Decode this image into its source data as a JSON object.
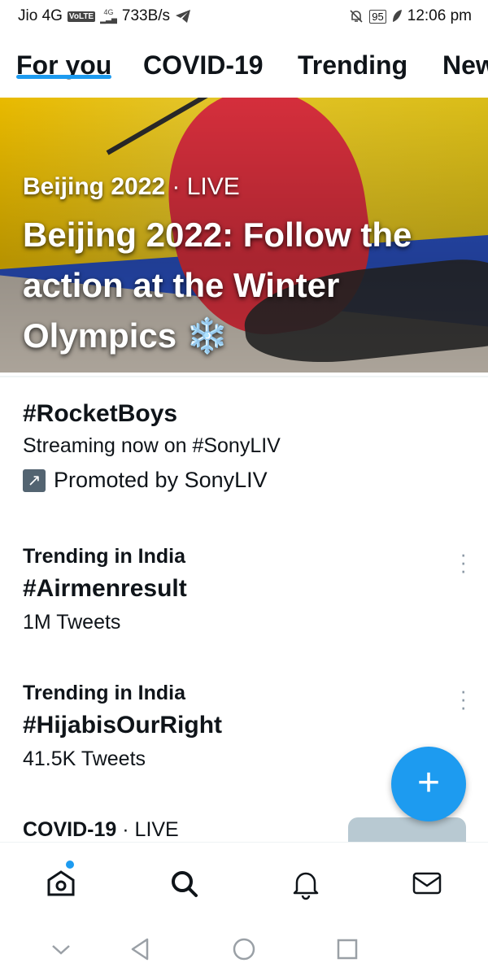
{
  "status_bar": {
    "carrier": "Jio 4G",
    "volte": "VoLTE",
    "network_type": "4G",
    "speed": "733B/s",
    "battery": "95",
    "time": "12:06 pm",
    "icons": [
      "telegram-icon",
      "mute-bell-icon",
      "battery-icon",
      "leaf-icon"
    ]
  },
  "tabs": [
    {
      "label": "For you",
      "active": true
    },
    {
      "label": "COVID-19",
      "active": false
    },
    {
      "label": "Trending",
      "active": false
    },
    {
      "label": "New",
      "active": false
    }
  ],
  "hero": {
    "category": "Beijing 2022",
    "live": "· LIVE",
    "title": "Beijing 2022: Follow the action at the Winter Olympics ❄️"
  },
  "trends": [
    {
      "title": "#RocketBoys",
      "subtitle": "Streaming now on #SonyLIV",
      "promoted": "Promoted by SonyLIV"
    },
    {
      "context": "Trending in India",
      "title": "#Airmenresult",
      "count": "1M Tweets"
    },
    {
      "context": "Trending in India",
      "title": "#HijabisOurRight",
      "count": "41.5K Tweets"
    },
    {
      "context": "COVID-19",
      "live": "· LIVE"
    }
  ],
  "fab": {
    "symbol": "+"
  },
  "accent_color": "#1d9bf0",
  "bottom_nav": [
    "home-icon",
    "search-icon",
    "notifications-icon",
    "messages-icon"
  ],
  "system_nav": [
    "collapse-icon",
    "back-icon",
    "home-circle-icon",
    "recents-icon"
  ]
}
